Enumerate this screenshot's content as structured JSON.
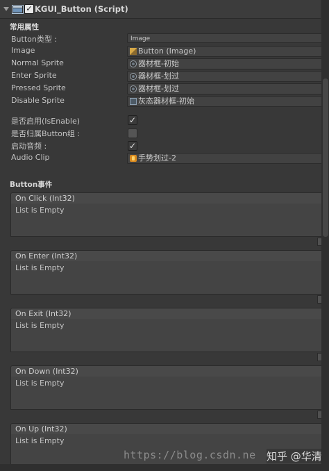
{
  "component": {
    "title": "KGUI_Button (Script)",
    "enabled": true
  },
  "common_section": {
    "title": "常用属性"
  },
  "properties": [
    {
      "label": "Button类型 :",
      "kind": "dropdown",
      "value": "Image"
    },
    {
      "label": "Image",
      "kind": "object",
      "icon": "image-component-icon",
      "value": "Button (Image)"
    },
    {
      "label": "Normal Sprite",
      "kind": "object",
      "icon": "sprite-icon",
      "value": "器材框-初始"
    },
    {
      "label": "Enter Sprite",
      "kind": "object",
      "icon": "sprite-icon",
      "value": "器材框-划过"
    },
    {
      "label": "Pressed Sprite",
      "kind": "object",
      "icon": "sprite-icon",
      "value": "器材框-划过"
    },
    {
      "label": "Disable Sprite",
      "kind": "object",
      "icon": "texture-icon",
      "value": "灰态器材框-初始"
    }
  ],
  "toggles": [
    {
      "label": "是否启用(IsEnable)",
      "checked": true
    },
    {
      "label": "是否归属Button组 :",
      "checked": false
    },
    {
      "label": "启动音频 :",
      "checked": true
    }
  ],
  "audio": {
    "label": "Audio Clip",
    "icon": "audio-clip-icon",
    "value": "手势划过-2"
  },
  "events_section": {
    "title": "Button事件"
  },
  "events": [
    {
      "name": "On Click (Int32)",
      "empty_text": "List is Empty"
    },
    {
      "name": "On Enter (Int32)",
      "empty_text": "List is Empty"
    },
    {
      "name": "On Exit (Int32)",
      "empty_text": "List is Empty"
    },
    {
      "name": "On Down (Int32)",
      "empty_text": "List is Empty"
    },
    {
      "name": "On Up (Int32)",
      "empty_text": "List is Empty"
    }
  ],
  "watermark": {
    "url": "https://blog.csdn.ne",
    "brand": "知乎 @华清"
  },
  "colors": {
    "background": "#383838",
    "field": "#424242",
    "event_header": "#494949"
  }
}
